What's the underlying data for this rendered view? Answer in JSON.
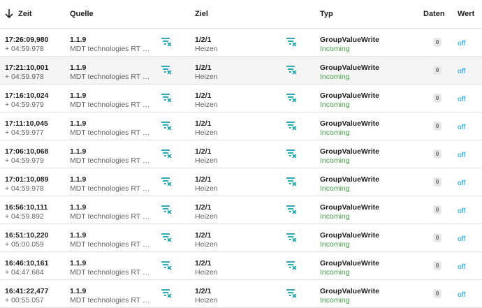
{
  "header": {
    "zeit": "Zeit",
    "quelle": "Quelle",
    "ziel": "Ziel",
    "typ": "Typ",
    "daten": "Daten",
    "wert": "Wert"
  },
  "colors": {
    "accent": "#039be5",
    "incoming": "#43a047",
    "filter_icon": "#0097a7"
  },
  "icons": {
    "sort": "arrow-down-icon",
    "filter": "filter-remove-icon"
  },
  "rows": [
    {
      "time": "17:26:09,980",
      "delta": "+ 04:59.978",
      "source_addr": "1.1.9",
      "source_name": "MDT technologies RT Bür…",
      "dest_addr": "1/2/1",
      "dest_name": "Heizen",
      "type": "GroupValueWrite",
      "direction": "Incoming",
      "data": "0",
      "value": "off"
    },
    {
      "time": "17:21:10,001",
      "delta": "+ 04:59.978",
      "source_addr": "1.1.9",
      "source_name": "MDT technologies RT Bür…",
      "dest_addr": "1/2/1",
      "dest_name": "Heizen",
      "type": "GroupValueWrite",
      "direction": "Incoming",
      "data": "0",
      "value": "off"
    },
    {
      "time": "17:16:10,024",
      "delta": "+ 04:59.979",
      "source_addr": "1.1.9",
      "source_name": "MDT technologies RT Bür…",
      "dest_addr": "1/2/1",
      "dest_name": "Heizen",
      "type": "GroupValueWrite",
      "direction": "Incoming",
      "data": "0",
      "value": "off"
    },
    {
      "time": "17:11:10,045",
      "delta": "+ 04:59.977",
      "source_addr": "1.1.9",
      "source_name": "MDT technologies RT Bür…",
      "dest_addr": "1/2/1",
      "dest_name": "Heizen",
      "type": "GroupValueWrite",
      "direction": "Incoming",
      "data": "0",
      "value": "off"
    },
    {
      "time": "17:06:10,068",
      "delta": "+ 04:59.979",
      "source_addr": "1.1.9",
      "source_name": "MDT technologies RT Bür…",
      "dest_addr": "1/2/1",
      "dest_name": "Heizen",
      "type": "GroupValueWrite",
      "direction": "Incoming",
      "data": "0",
      "value": "off"
    },
    {
      "time": "17:01:10,089",
      "delta": "+ 04:59.978",
      "source_addr": "1.1.9",
      "source_name": "MDT technologies RT Bür…",
      "dest_addr": "1/2/1",
      "dest_name": "Heizen",
      "type": "GroupValueWrite",
      "direction": "Incoming",
      "data": "0",
      "value": "off"
    },
    {
      "time": "16:56:10,111",
      "delta": "+ 04:59.892",
      "source_addr": "1.1.9",
      "source_name": "MDT technologies RT Bür…",
      "dest_addr": "1/2/1",
      "dest_name": "Heizen",
      "type": "GroupValueWrite",
      "direction": "Incoming",
      "data": "0",
      "value": "off"
    },
    {
      "time": "16:51:10,220",
      "delta": "+ 05:00.059",
      "source_addr": "1.1.9",
      "source_name": "MDT technologies RT Bür…",
      "dest_addr": "1/2/1",
      "dest_name": "Heizen",
      "type": "GroupValueWrite",
      "direction": "Incoming",
      "data": "0",
      "value": "off"
    },
    {
      "time": "16:46:10,161",
      "delta": "+ 04:47.684",
      "source_addr": "1.1.9",
      "source_name": "MDT technologies RT Bür…",
      "dest_addr": "1/2/1",
      "dest_name": "Heizen",
      "type": "GroupValueWrite",
      "direction": "Incoming",
      "data": "0",
      "value": "off"
    },
    {
      "time": "16:41:22,477",
      "delta": "+ 00:55.057",
      "source_addr": "1.1.9",
      "source_name": "MDT technologies RT Bür…",
      "dest_addr": "1/2/1",
      "dest_name": "Heizen",
      "type": "GroupValueWrite",
      "direction": "Incoming",
      "data": "0",
      "value": "off"
    }
  ]
}
